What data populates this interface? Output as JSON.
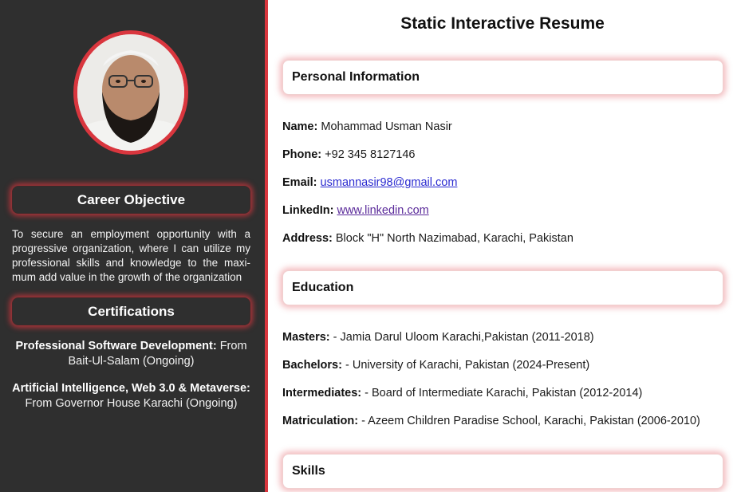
{
  "page": {
    "title": "Static Interactive Resume"
  },
  "sidebar": {
    "career_heading": "Career Objective",
    "career_text": "To secure an employment opportunity with a progressive organization, where I can utilize my professional skills and knowledge to the maxi-mum add value in the growth of the organization",
    "cert_heading": "Certifications",
    "certs": [
      {
        "title": "Professional Software Development:",
        "detail": "From Bait-Ul-Salam (Ongoing)"
      },
      {
        "title": "Artificial Intelligence, Web 3.0 & Metaverse:",
        "detail": "From Governor House Karachi (Ongoing)"
      }
    ]
  },
  "personal": {
    "heading": "Personal Information",
    "name_label": "Name:",
    "name": "Mohammad Usman Nasir",
    "phone_label": "Phone:",
    "phone": "+92 345 8127146",
    "email_label": "Email:",
    "email": "usmannasir98@gmail.com",
    "linkedin_label": "LinkedIn:",
    "linkedin": "www.linkedin.com",
    "address_label": "Address:",
    "address": "Block \"H\" North Nazimabad, Karachi, Pakistan"
  },
  "education": {
    "heading": "Education",
    "items": [
      {
        "label": "Masters:",
        "text": "- Jamia Darul Uloom Karachi,Pakistan (2011-2018)"
      },
      {
        "label": "Bachelors:",
        "text": "- University of Karachi, Pakistan (2024-Present)"
      },
      {
        "label": "Intermediates:",
        "text": "- Board of Intermediate Karachi, Pakistan (2012-2014)"
      },
      {
        "label": "Matriculation:",
        "text": "- Azeem Children Paradise School, Karachi, Pakistan (2006-2010)"
      }
    ]
  },
  "skills": {
    "heading": "Skills"
  },
  "colors": {
    "accent": "#d9363e",
    "sidebar_bg": "#2f2f2f"
  },
  "icons": {
    "avatar": "profile-photo"
  }
}
